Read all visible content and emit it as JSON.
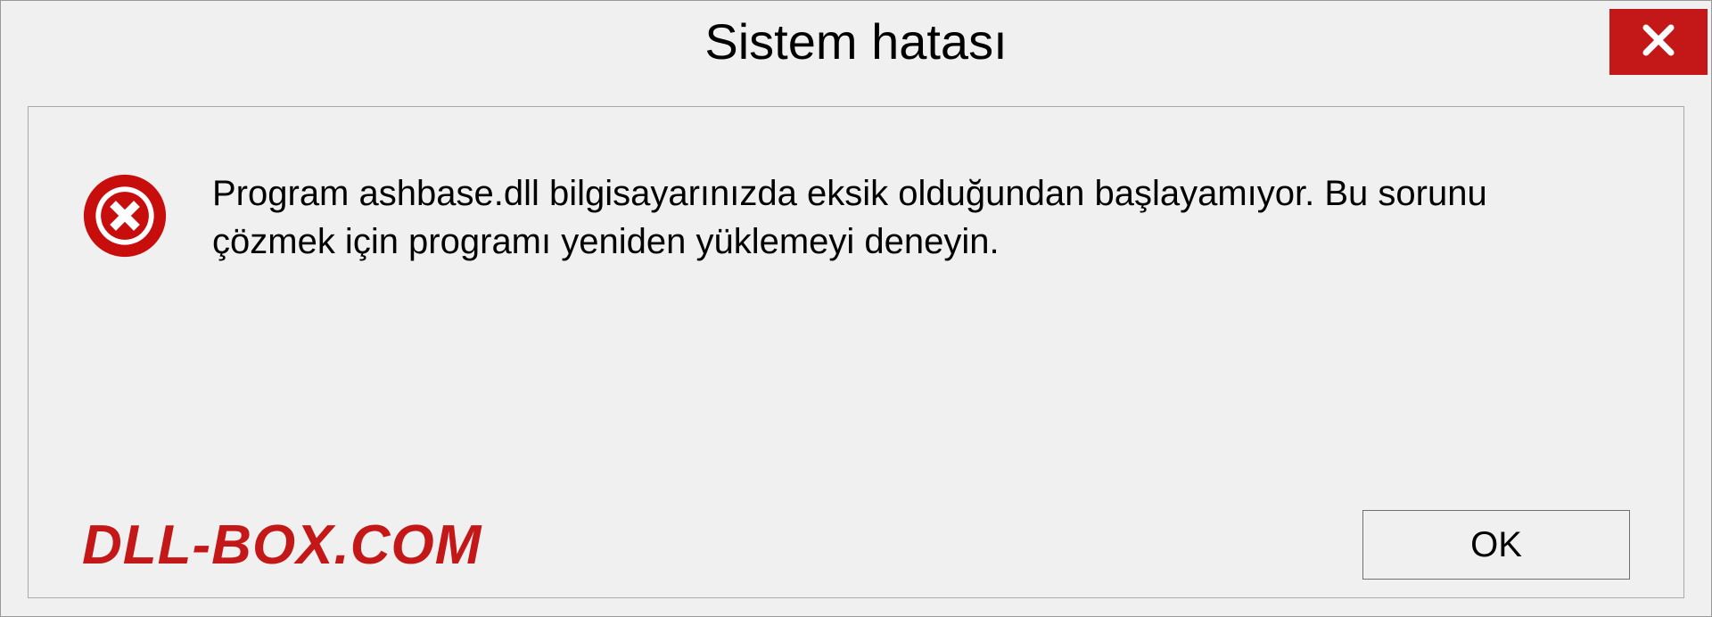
{
  "dialog": {
    "title": "Sistem hatası",
    "message": "Program ashbase.dll bilgisayarınızda eksik olduğundan başlayamıyor. Bu sorunu çözmek için programı yeniden yüklemeyi deneyin.",
    "ok_label": "OK"
  },
  "watermark": "DLL-BOX.COM",
  "colors": {
    "close_button": "#c41818",
    "watermark": "#c41818",
    "error_icon": "#c80d0d"
  }
}
